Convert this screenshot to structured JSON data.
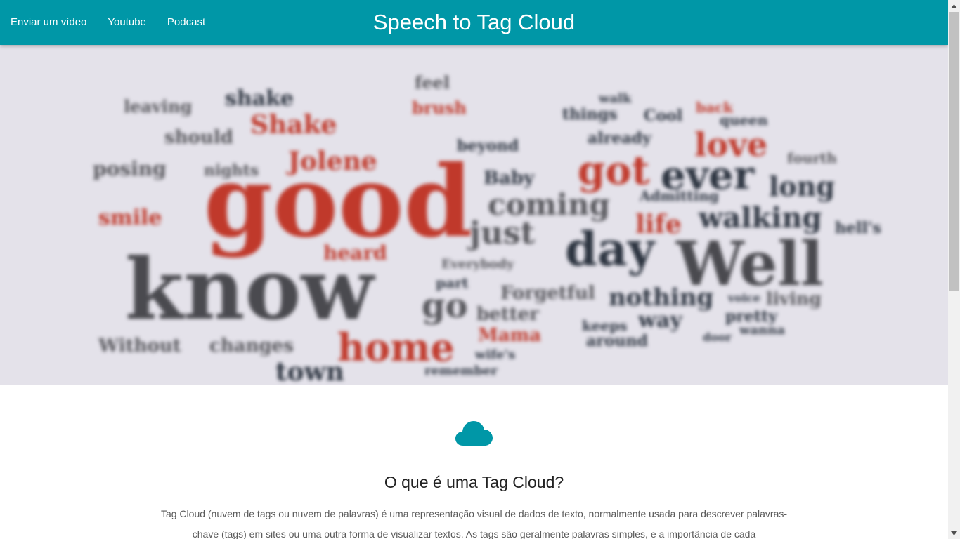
{
  "navbar": {
    "links": [
      "Enviar um vídeo",
      "Youtube",
      "Podcast"
    ],
    "title": "Speech to Tag Cloud",
    "background_color": "#0097a7"
  },
  "hero": {
    "words": [
      {
        "text": "good",
        "color": "#c0392b"
      },
      {
        "text": "know",
        "color": "#4a4a4f"
      },
      {
        "text": "Well",
        "color": "#4a4a4f"
      },
      {
        "text": "day",
        "color": "#2c3440"
      },
      {
        "text": "ever",
        "color": "#2c3440"
      },
      {
        "text": "got",
        "color": "#c0392b"
      },
      {
        "text": "home",
        "color": "#c0392b"
      },
      {
        "text": "love",
        "color": "#c0392b"
      },
      {
        "text": "go",
        "color": "#55555a"
      },
      {
        "text": "coming",
        "color": "#55555a"
      },
      {
        "text": "walking",
        "color": "#2c3440"
      },
      {
        "text": "long",
        "color": "#2c3440"
      },
      {
        "text": "just",
        "color": "#55555a"
      },
      {
        "text": "nothing",
        "color": "#2c3440"
      },
      {
        "text": "life",
        "color": "#c0392b"
      },
      {
        "text": "way",
        "color": "#2c3440"
      },
      {
        "text": "living",
        "color": "#55555a"
      },
      {
        "text": "pretty",
        "color": "#2c3440"
      },
      {
        "text": "Baby",
        "color": "#2c3440"
      },
      {
        "text": "better",
        "color": "#55555a"
      },
      {
        "text": "Mama",
        "color": "#c0392b"
      },
      {
        "text": "heard",
        "color": "#c0392b"
      },
      {
        "text": "Shake",
        "color": "#c0392b"
      },
      {
        "text": "Jolene",
        "color": "#c0392b"
      },
      {
        "text": "shake",
        "color": "#2c3440"
      },
      {
        "text": "already",
        "color": "#2c3440"
      },
      {
        "text": "things",
        "color": "#2c3440"
      },
      {
        "text": "Forgetful",
        "color": "#55555a"
      },
      {
        "text": "Without",
        "color": "#55555a"
      },
      {
        "text": "changes",
        "color": "#55555a"
      },
      {
        "text": "keeps",
        "color": "#2c3440"
      },
      {
        "text": "around",
        "color": "#2c3440"
      },
      {
        "text": "fourth",
        "color": "#55555a"
      },
      {
        "text": "hell's",
        "color": "#2c3440"
      },
      {
        "text": "town",
        "color": "#2c3440"
      },
      {
        "text": "queen",
        "color": "#2c3440"
      },
      {
        "text": "Admitting",
        "color": "#2c3440"
      },
      {
        "text": "beyond",
        "color": "#2c3440"
      },
      {
        "text": "Everybody",
        "color": "#55555a"
      },
      {
        "text": "wanna",
        "color": "#2c3440"
      },
      {
        "text": "wife's",
        "color": "#2c3440"
      },
      {
        "text": "leaving",
        "color": "#55555a"
      },
      {
        "text": "posing",
        "color": "#55555a"
      },
      {
        "text": "should",
        "color": "#55555a"
      },
      {
        "text": "nights",
        "color": "#55555a"
      },
      {
        "text": "brush",
        "color": "#c0392b"
      },
      {
        "text": "smile",
        "color": "#c0392b"
      },
      {
        "text": "feel",
        "color": "#55555a"
      },
      {
        "text": "back",
        "color": "#c0392b"
      },
      {
        "text": "Cool",
        "color": "#2c3440"
      },
      {
        "text": "walk",
        "color": "#2c3440"
      },
      {
        "text": "part",
        "color": "#2c3440"
      },
      {
        "text": "door",
        "color": "#2c3440"
      },
      {
        "text": "voice",
        "color": "#2c3440"
      },
      {
        "text": "remember",
        "color": "#2c3440"
      }
    ]
  },
  "section": {
    "icon": "cloud-icon",
    "icon_color": "#0097a7",
    "title": "O que é uma Tag Cloud?",
    "text": "Tag Cloud (nuvem de tags ou nuvem de palavras) é uma representação visual de dados de texto, normalmente usada para descrever palavras-chave (tags) em sites ou uma outra forma de visualizar textos. As tags são geralmente palavras simples, e a importância de cada"
  }
}
